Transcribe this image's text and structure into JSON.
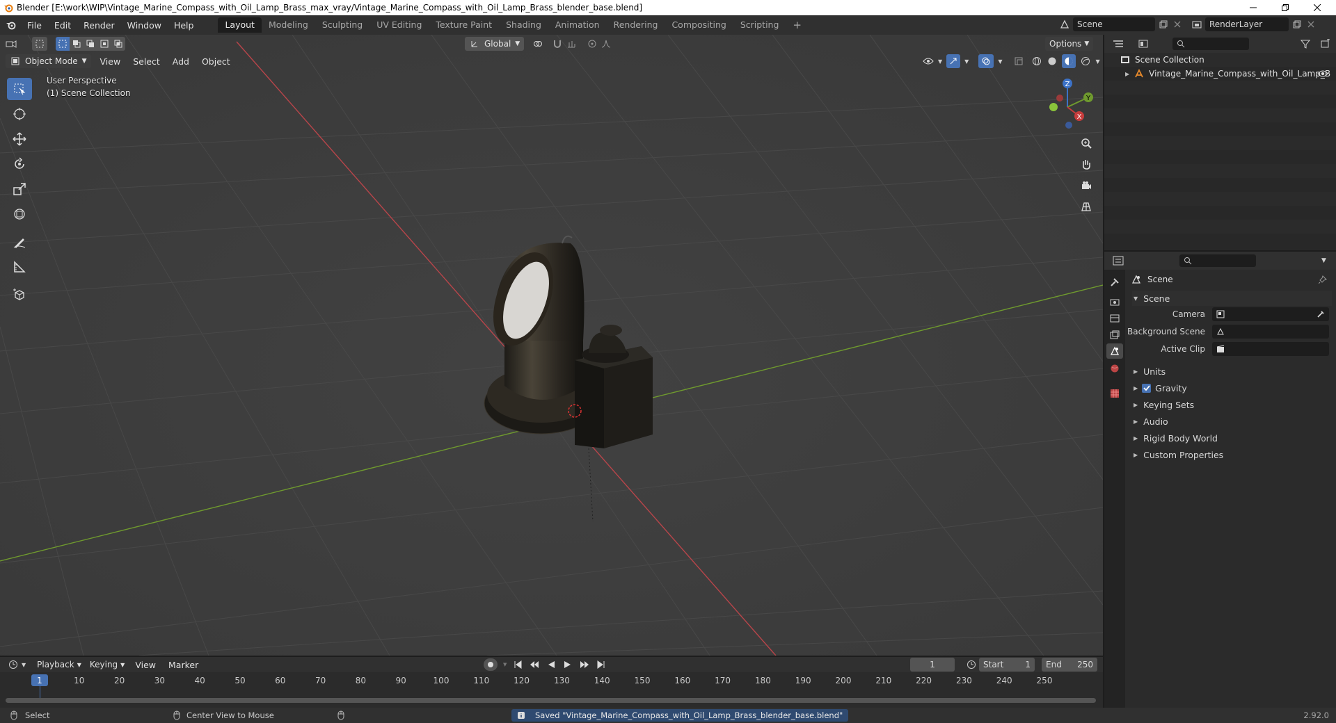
{
  "window": {
    "title": "Blender [E:\\work\\WIP\\Vintage_Marine_Compass_with_Oil_Lamp_Brass_max_vray/Vintage_Marine_Compass_with_Oil_Lamp_Brass_blender_base.blend]"
  },
  "menus": [
    "File",
    "Edit",
    "Render",
    "Window",
    "Help"
  ],
  "workspaces": [
    {
      "label": "Layout",
      "active": true
    },
    {
      "label": "Modeling",
      "active": false
    },
    {
      "label": "Sculpting",
      "active": false
    },
    {
      "label": "UV Editing",
      "active": false
    },
    {
      "label": "Texture Paint",
      "active": false
    },
    {
      "label": "Shading",
      "active": false
    },
    {
      "label": "Animation",
      "active": false
    },
    {
      "label": "Rendering",
      "active": false
    },
    {
      "label": "Compositing",
      "active": false
    },
    {
      "label": "Scripting",
      "active": false
    }
  ],
  "topbar": {
    "scene": "Scene",
    "render_layer": "RenderLayer"
  },
  "viewport": {
    "mode": "Object Mode",
    "menus": [
      "View",
      "Select",
      "Add",
      "Object"
    ],
    "orientation": "Global",
    "options": "Options",
    "overlay_line1": "User Perspective",
    "overlay_line2": "(1) Scene Collection",
    "gizmo": {
      "x": "X",
      "y": "Y",
      "z": "Z"
    }
  },
  "outliner": {
    "root": "Scene Collection",
    "items": [
      {
        "label": "Vintage_Marine_Compass_with_Oil_Lamp_B"
      }
    ]
  },
  "properties": {
    "context": "Scene",
    "section": "Scene",
    "fields": [
      {
        "label": "Camera"
      },
      {
        "label": "Background Scene"
      },
      {
        "label": "Active Clip"
      }
    ],
    "panels": [
      {
        "label": "Units",
        "checkbox": false
      },
      {
        "label": "Gravity",
        "checkbox": true
      },
      {
        "label": "Keying Sets",
        "checkbox": false
      },
      {
        "label": "Audio",
        "checkbox": false
      },
      {
        "label": "Rigid Body World",
        "checkbox": false
      },
      {
        "label": "Custom Properties",
        "checkbox": false
      }
    ]
  },
  "timeline": {
    "menus": [
      "Playback",
      "Keying",
      "View",
      "Marker"
    ],
    "current_frame": "1",
    "start_label": "Start",
    "start": "1",
    "end_label": "End",
    "end": "250",
    "ruler": [
      "1",
      "10",
      "20",
      "30",
      "40",
      "50",
      "60",
      "70",
      "80",
      "90",
      "100",
      "110",
      "120",
      "130",
      "140",
      "150",
      "160",
      "170",
      "180",
      "190",
      "200",
      "210",
      "220",
      "230",
      "240",
      "250"
    ]
  },
  "statusbar": {
    "select": "Select",
    "center": "Center View to Mouse",
    "message": "Saved \"Vintage_Marine_Compass_with_Oil_Lamp_Brass_blender_base.blend\"",
    "version": "2.92.0"
  },
  "colors": {
    "accent": "#4772b3",
    "x_axis": "#c73c3c",
    "y_axis": "#6a9a2a",
    "z_axis": "#3c72c7"
  }
}
